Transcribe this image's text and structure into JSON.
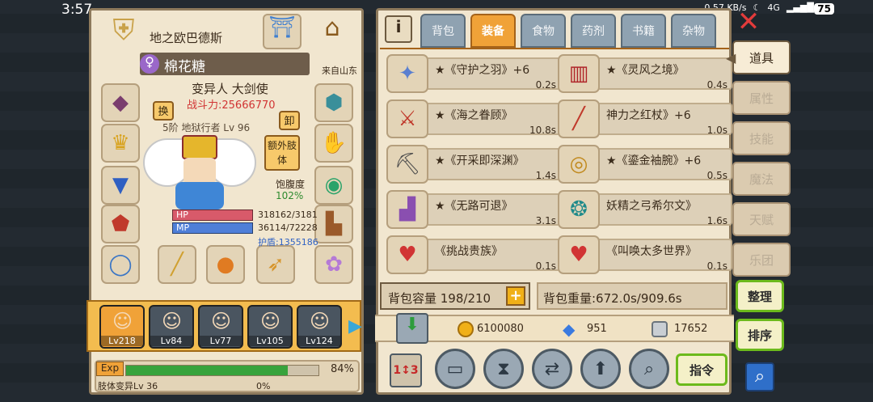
{
  "status_bar": {
    "time": "3:57",
    "net_speed": "0.57 KB/s",
    "signal": "4G",
    "battery": "75"
  },
  "character": {
    "location": "地之欧巴德斯",
    "name": "棉花糖",
    "origin": "来自山东",
    "class": "变异人 大剑使",
    "power_label": "战斗力:25666770",
    "tier_text": "5阶 地狱行者 Lv 96",
    "swap_label": "换",
    "unequip_label": "卸",
    "extra_limb_label": "额外肢体",
    "satiety_label": "饱腹度",
    "satiety_value": "102%",
    "hp_label": "HP",
    "hp_value": "318162/3181",
    "mp_label": "MP",
    "mp_value": "36114/72228",
    "shield_value": "护盾:1355186",
    "exp_label": "Exp",
    "exp_percent": "84%",
    "exp_fraction": 0.84,
    "limb_label": "肢体变异Lv 36",
    "limb_percent": "0%"
  },
  "party": [
    {
      "level": "Lv218"
    },
    {
      "level": "Lv84"
    },
    {
      "level": "Lv77"
    },
    {
      "level": "Lv105"
    },
    {
      "level": "Lv124"
    }
  ],
  "tabs": [
    "背包",
    "装备",
    "食物",
    "药剂",
    "书籍",
    "杂物"
  ],
  "active_tab": "装备",
  "items": [
    {
      "name": "★《守护之羽》+6",
      "time": "0.2s"
    },
    {
      "name": "★《灵风之境》",
      "time": "0.4s"
    },
    {
      "name": "★《海之眷顾》",
      "time": "10.8s"
    },
    {
      "name": "神力之红杖》+6",
      "time": "1.0s"
    },
    {
      "name": "★《开采即深渊》",
      "time": "1.4s"
    },
    {
      "name": "★《鎏金袖腕》+6",
      "time": "0.5s"
    },
    {
      "name": "★《无路可退》",
      "time": "3.1s"
    },
    {
      "name": "妖精之弓希尔文》",
      "time": "1.6s"
    },
    {
      "name": "《挑战贵族》",
      "time": "0.1s"
    },
    {
      "name": "《叫唤太多世界》",
      "time": "0.1s"
    }
  ],
  "capacity": {
    "label": "背包容量 198/210",
    "plus": "+"
  },
  "weight_label": "背包重量:672.0s/909.6s",
  "currency": {
    "gold": "6100080",
    "diamond": "951",
    "silver": "17652"
  },
  "side_menu": [
    "道具",
    "属性",
    "技能",
    "魔法",
    "天赋",
    "乐团"
  ],
  "active_side": "道具",
  "buttons": {
    "organize": "整理",
    "sort": "排序",
    "command": "指令",
    "close": "✕"
  },
  "colors": {
    "accent": "#f0a238",
    "green": "#6cba1c",
    "hp": "#d85a6a",
    "mp": "#4f7fd8",
    "exp": "#38a33c"
  }
}
